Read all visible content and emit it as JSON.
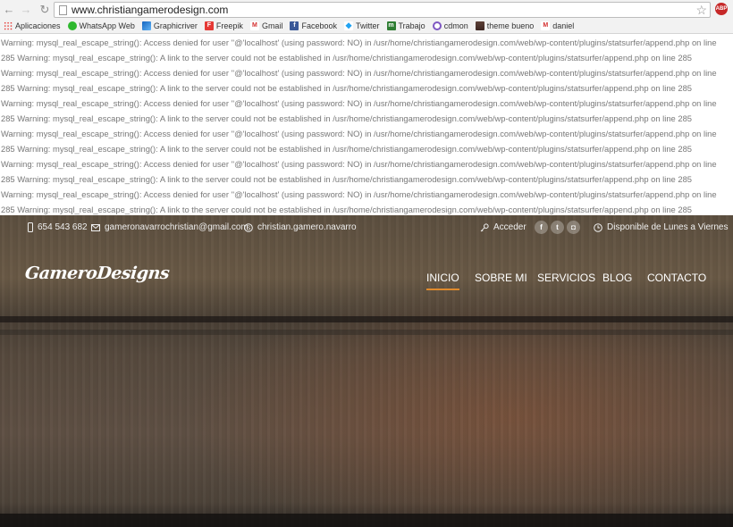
{
  "browser": {
    "url": "www.christiangamerodesign.com",
    "abp_label": "ABP",
    "bookmarks": [
      {
        "label": "Aplicaciones",
        "icon": "apps-icon",
        "glyph": ""
      },
      {
        "label": "WhatsApp Web",
        "icon": "whatsapp-icon",
        "glyph": ""
      },
      {
        "label": "Graphicriver",
        "icon": "graphicriver-icon",
        "glyph": ""
      },
      {
        "label": "Freepik",
        "icon": "freepik-icon",
        "glyph": "F"
      },
      {
        "label": "Gmail",
        "icon": "gmail-icon",
        "glyph": "M"
      },
      {
        "label": "Facebook",
        "icon": "facebook-icon",
        "glyph": "f"
      },
      {
        "label": "Twitter",
        "icon": "twitter-icon",
        "glyph": "🐦"
      },
      {
        "label": "Trabajo",
        "icon": "trabajo-icon",
        "glyph": "m"
      },
      {
        "label": "cdmon",
        "icon": "cdmon-icon",
        "glyph": ""
      },
      {
        "label": "theme bueno",
        "icon": "theme-icon",
        "glyph": ""
      },
      {
        "label": "daniel",
        "icon": "gmail-icon",
        "glyph": "M"
      }
    ]
  },
  "warnings": [
    "Warning: mysql_real_escape_string(): Access denied for user ''@'localhost' (using password: NO) in /usr/home/christiangamerodesign.com/web/wp-content/plugins/statsurfer/append.php on line",
    "285 Warning: mysql_real_escape_string(): A link to the server could not be established in /usr/home/christiangamerodesign.com/web/wp-content/plugins/statsurfer/append.php on line 285",
    "Warning: mysql_real_escape_string(): Access denied for user ''@'localhost' (using password: NO) in /usr/home/christiangamerodesign.com/web/wp-content/plugins/statsurfer/append.php on line",
    "285 Warning: mysql_real_escape_string(): A link to the server could not be established in /usr/home/christiangamerodesign.com/web/wp-content/plugins/statsurfer/append.php on line 285",
    "Warning: mysql_real_escape_string(): Access denied for user ''@'localhost' (using password: NO) in /usr/home/christiangamerodesign.com/web/wp-content/plugins/statsurfer/append.php on line",
    "285 Warning: mysql_real_escape_string(): A link to the server could not be established in /usr/home/christiangamerodesign.com/web/wp-content/plugins/statsurfer/append.php on line 285",
    "Warning: mysql_real_escape_string(): Access denied for user ''@'localhost' (using password: NO) in /usr/home/christiangamerodesign.com/web/wp-content/plugins/statsurfer/append.php on line",
    "285 Warning: mysql_real_escape_string(): A link to the server could not be established in /usr/home/christiangamerodesign.com/web/wp-content/plugins/statsurfer/append.php on line 285",
    "Warning: mysql_real_escape_string(): Access denied for user ''@'localhost' (using password: NO) in /usr/home/christiangamerodesign.com/web/wp-content/plugins/statsurfer/append.php on line",
    "285 Warning: mysql_real_escape_string(): A link to the server could not be established in /usr/home/christiangamerodesign.com/web/wp-content/plugins/statsurfer/append.php on line 285",
    "Warning: mysql_real_escape_string(): Access denied for user ''@'localhost' (using password: NO) in /usr/home/christiangamerodesign.com/web/wp-content/plugins/statsurfer/append.php on line",
    "285 Warning: mysql_real_escape_string(): A link to the server could not be established in /usr/home/christiangamerodesign.com/web/wp-content/plugins/statsurfer/append.php on line 285"
  ],
  "site": {
    "topbar": {
      "phone": "654 543 682",
      "email": "gameronavarrochristian@gmail.com",
      "skype": "christian.gamero.navarro",
      "login": "Acceder",
      "availability": "Disponible de Lunes a Viernes",
      "social": [
        {
          "icon": "facebook-icon",
          "glyph": "f"
        },
        {
          "icon": "twitter-icon",
          "glyph": "t"
        },
        {
          "icon": "instagram-icon",
          "glyph": "◘"
        }
      ]
    },
    "logo": "GameroDesigns",
    "nav": [
      {
        "label": "INICIO",
        "active": true
      },
      {
        "label": "SOBRE MI",
        "active": false
      },
      {
        "label": "SERVICIOS",
        "active": false
      },
      {
        "label": "BLOG",
        "active": false
      },
      {
        "label": "CONTACTO",
        "active": false
      }
    ],
    "colors": {
      "nav_active_underline": "#e08a2c"
    }
  }
}
